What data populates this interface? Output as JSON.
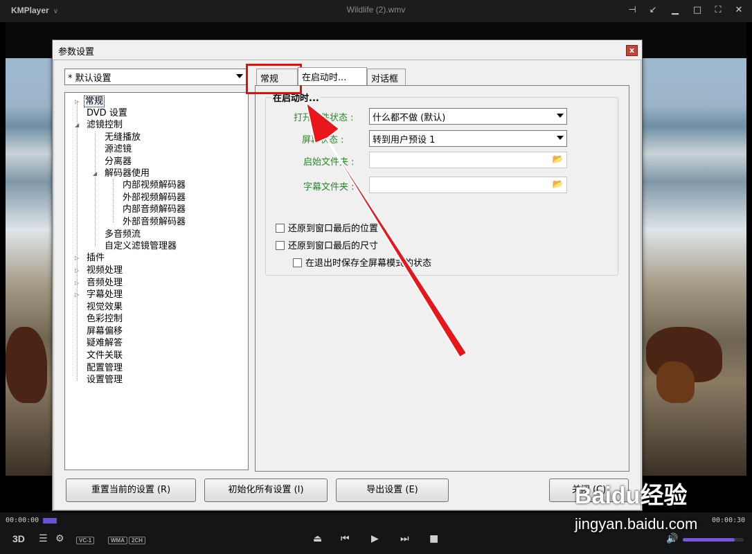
{
  "player": {
    "app_name": "KMPlayer",
    "file_title": "Wildlife (2).wmv",
    "time_elapsed": "00:00:00",
    "time_total": "00:00:30",
    "badges": [
      "VC-1",
      "WMA",
      "2CH"
    ],
    "volume_fraction": 0.85,
    "accent_color": "#7a52e0"
  },
  "dialog": {
    "title": "参数设置",
    "close_glyph": "x",
    "preset": "* 默认设置",
    "tabs": [
      "常规",
      "在启动时...",
      "对话框"
    ],
    "group_title": "在启动时...",
    "fields": {
      "open_state_label": "打开文件状态 :",
      "open_state_value": "什么都不做 (默认)",
      "screen_state_label": "屏幕状态 :",
      "screen_state_value": "转到用户预设 1",
      "start_folder_label": "启始文件夹 :",
      "subtitle_folder_label": "字幕文件夹 :"
    },
    "checkboxes": [
      "还原到窗口最后的位置",
      "还原到窗口最后的尺寸",
      "在退出时保存全屏幕模式的状态"
    ],
    "tree": [
      "常规",
      "DVD 设置",
      "滤镜控制",
      "无缝播放",
      "源滤镜",
      "分离器",
      "解码器使用",
      "内部视频解码器",
      "外部视频解码器",
      "内部音频解码器",
      "外部音频解码器",
      "多音频流",
      "自定义滤镜管理器",
      "插件",
      "视频处理",
      "音频处理",
      "字幕处理",
      "视觉效果",
      "色彩控制",
      "屏幕偏移",
      "疑难解答",
      "文件关联",
      "配置管理",
      "设置管理"
    ],
    "buttons": {
      "reset": "重置当前的设置 (R)",
      "init": "初始化所有设置 (I)",
      "export": "导出设置 (E)",
      "close": "关闭 (C)"
    }
  },
  "watermark": {
    "brand": "Baidu经验",
    "url": "jingyan.baidu.com"
  }
}
